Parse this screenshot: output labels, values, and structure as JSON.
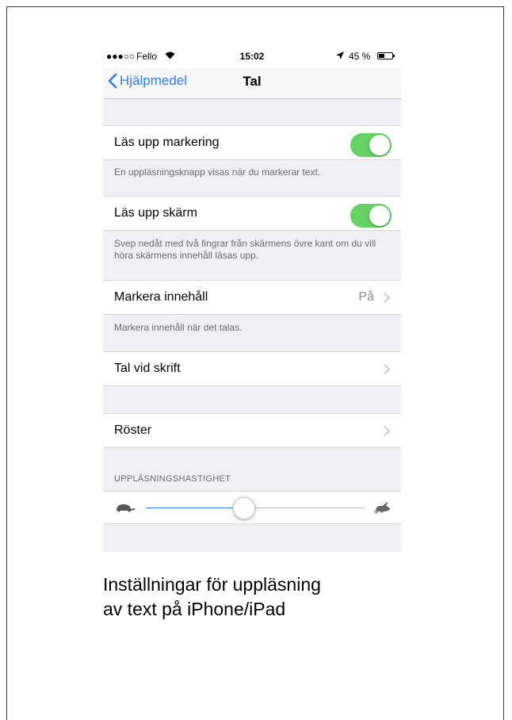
{
  "status_bar": {
    "signal": "●●●○○",
    "carrier": "Fello",
    "time": "15:02",
    "battery": "45 %",
    "battery_level": 0.45
  },
  "nav": {
    "back_label": "Hjälpmedel",
    "title": "Tal"
  },
  "rows": {
    "speak_selection": {
      "label": "Läs upp markering",
      "on": true,
      "footer": "En uppläsningsknapp visas när du markerar text."
    },
    "speak_screen": {
      "label": "Läs upp skärm",
      "on": true,
      "footer": "Svep nedåt med två fingrar från skärmens övre kant om du vill höra skärmens innehåll läsas upp."
    },
    "highlight_content": {
      "label": "Markera innehåll",
      "value": "På",
      "footer": "Markera innehåll när det talas."
    },
    "typing_feedback": {
      "label": "Tal vid skrift"
    },
    "voices": {
      "label": "Röster"
    }
  },
  "speaking_rate": {
    "header": "UPPLÄSNINGSHASTIGHET",
    "value": 0.45
  },
  "caption": {
    "line1": "Inställningar för uppläsning",
    "line2": "av text på iPhone/iPad"
  },
  "colors": {
    "accent": "#2f7cf6",
    "toggle_on": "#64d264"
  }
}
